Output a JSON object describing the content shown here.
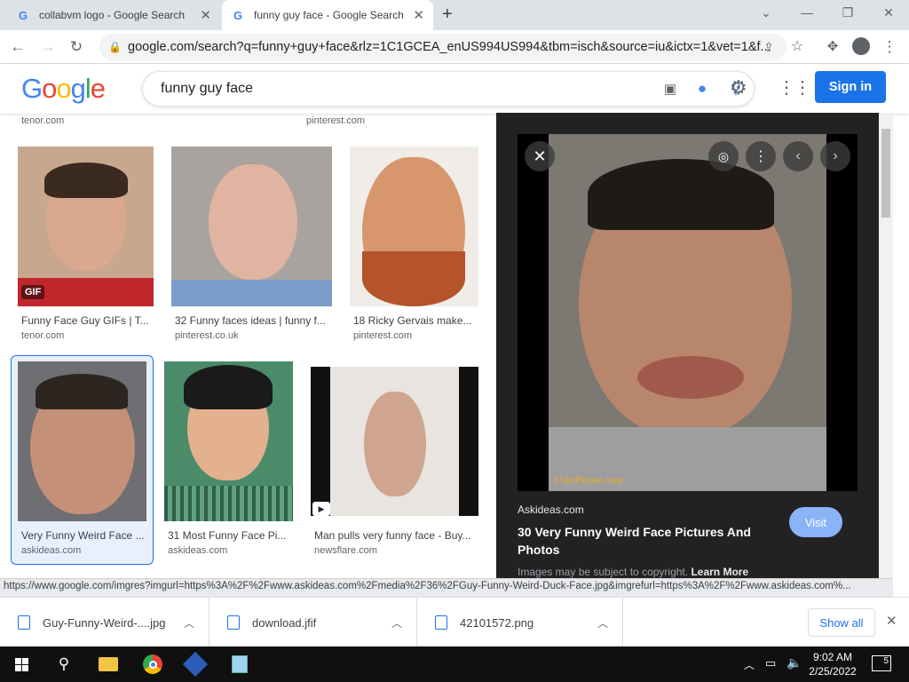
{
  "tabs": [
    {
      "title": "collabvm logo - Google Search",
      "favicon": "google-g-icon"
    },
    {
      "title": "funny guy face - Google Search",
      "favicon": "google-g-icon"
    }
  ],
  "address": {
    "url": "google.com/search?q=funny+guy+face&rlz=1C1GCEA_enUS994US994&tbm=isch&source=iu&ictx=1&vet=1&f..."
  },
  "google": {
    "logo": "Google",
    "query": "funny guy face",
    "signin": "Sign in"
  },
  "top_sources": [
    "tenor.com",
    "pinterest.com"
  ],
  "results": [
    {
      "caption": "Funny Face Guy GIFs | T...",
      "source": "tenor.com",
      "badge": "GIF"
    },
    {
      "caption": "32 Funny faces ideas | funny f...",
      "source": "pinterest.co.uk"
    },
    {
      "caption": "18 Ricky Gervais make...",
      "source": "pinterest.com"
    },
    {
      "caption": "Very Funny Weird Face ...",
      "source": "askideas.com"
    },
    {
      "caption": "31 Most Funny Face Pi...",
      "source": "askideas.com"
    },
    {
      "caption": "Man pulls very funny face - Buy...",
      "source": "newsflare.com"
    }
  ],
  "preview": {
    "source": "Askideas.com",
    "title": "30 Very Funny Weird Face Pictures And Photos",
    "visit": "Visit",
    "copyright": "Images may be subject to copyright.",
    "learn_more": "Learn More",
    "watermark": "UsinPeone.com"
  },
  "status_url": "https://www.google.com/imgres?imgurl=https%3A%2F%2Fwww.askideas.com%2Fmedia%2F36%2FGuy-Funny-Weird-Duck-Face.jpg&imgrefurl=https%3A%2F%2Fwww.askideas.com%...",
  "downloads": [
    {
      "name": "Guy-Funny-Weird-....jpg"
    },
    {
      "name": "download.jfif"
    },
    {
      "name": "42101572.png"
    }
  ],
  "show_all": "Show all",
  "clock": {
    "time": "9:02 AM",
    "date": "2/25/2022"
  },
  "notification_count": "5"
}
